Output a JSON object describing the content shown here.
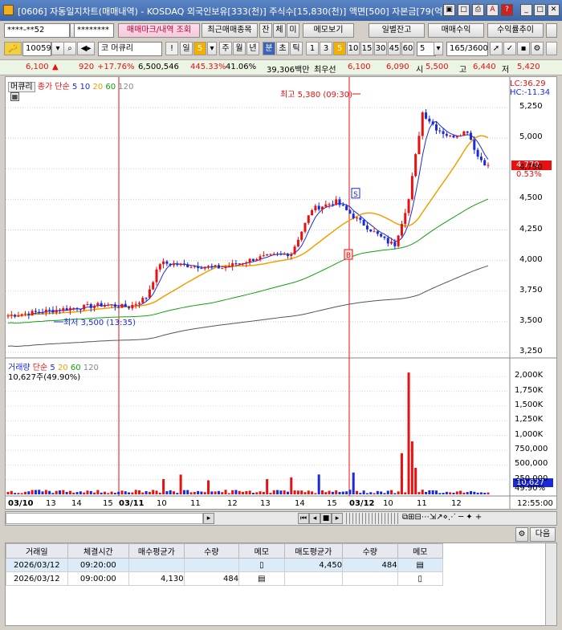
{
  "window": {
    "title": "[0606] 자동일지차트(매매내역) - KOSDAQ 외국인보유[333(천)] 주식수[15,830(천)] 액면[500] 자본금[79(억)"
  },
  "toolbar1": {
    "account": "****-**52",
    "password": "********",
    "btn_trade_marks": "매매마크/내역 조회",
    "btn_recent": "최근매매종목",
    "tab_jan": "잔",
    "tab_che": "체",
    "tab_mi": "미",
    "btn_memo": "메모보기",
    "btn_daily_balance": "일별잔고",
    "btn_trade_profit": "매매수익",
    "btn_return_trend": "수익률추이"
  },
  "toolbar2": {
    "code": "100590",
    "name": "머큐리",
    "periods": [
      "일",
      "5",
      "주",
      "월",
      "년",
      "분",
      "초",
      "틱",
      "1",
      "3",
      "5",
      "10",
      "15",
      "30",
      "45",
      "60",
      "5"
    ],
    "count": "165/3600"
  },
  "quote": {
    "price": "6,100",
    "change": "920",
    "rate": "+17.76%",
    "volume": "6,500,546",
    "vol_rate": "445.33%",
    "turnover": "41.06%",
    "amount": "39,306백만",
    "ask_label": "최우선",
    "ask": "6,100",
    "bid": "6,090",
    "open_label": "시",
    "open": "5,500",
    "high_label": "고",
    "high": "6,440",
    "low_label": "저",
    "low": "5,420"
  },
  "chart": {
    "price_legend": {
      "name": "머큐리",
      "ma_label": "종가 단순",
      "ma": [
        "5",
        "10",
        "20",
        "60",
        "120"
      ]
    },
    "lc": "LC:36.29",
    "hc": "HC:-11.34",
    "y_ticks": [
      "5,250",
      "5,000",
      "4,750",
      "4,500",
      "4,250",
      "4,000",
      "3,750",
      "3,500",
      "3,250"
    ],
    "last_price": "4,770",
    "last_rate": "0.53%",
    "high_note": "최고 5,380 (09:30)",
    "low_note": "최저 3,500 (13:35)",
    "vol_legend": {
      "name": "거래량",
      "ma_label": "단순",
      "ma": [
        "5",
        "20",
        "60",
        "120"
      ]
    },
    "vol_info": "10,627주(49.90%)",
    "vol_ticks": [
      "2,000K",
      "1,750K",
      "1,500K",
      "1,250K",
      "1,000K",
      "750,000",
      "500,000",
      "250,000",
      "49.90%"
    ],
    "vol_last": "10,627",
    "x_labels": [
      "03/10",
      "13",
      "14",
      "15",
      "03/11",
      "10",
      "11",
      "12",
      "13",
      "14",
      "15",
      "03/12",
      "10",
      "11",
      "12"
    ],
    "time_label": "12:55:00",
    "marks": {
      "sell": "S",
      "buy": "B"
    },
    "colors": {
      "up": "#e81010",
      "down": "#1a2ad8",
      "ma5": "#1a2ad8",
      "ma20": "#f2a000",
      "ma60": "#10a010",
      "ma120": "#555555"
    }
  },
  "bottom": {
    "btn_next": "다음"
  },
  "table": {
    "headers": [
      "거래일",
      "체결시간",
      "매수평균가",
      "수량",
      "메모",
      "매도평균가",
      "수량",
      "메모"
    ],
    "rows": [
      [
        "2026/03/12",
        "09:20:00",
        "",
        "",
        "",
        "4,450",
        "484",
        ""
      ],
      [
        "2026/03/12",
        "09:00:00",
        "4,130",
        "484",
        "",
        "",
        "",
        ""
      ]
    ]
  }
}
